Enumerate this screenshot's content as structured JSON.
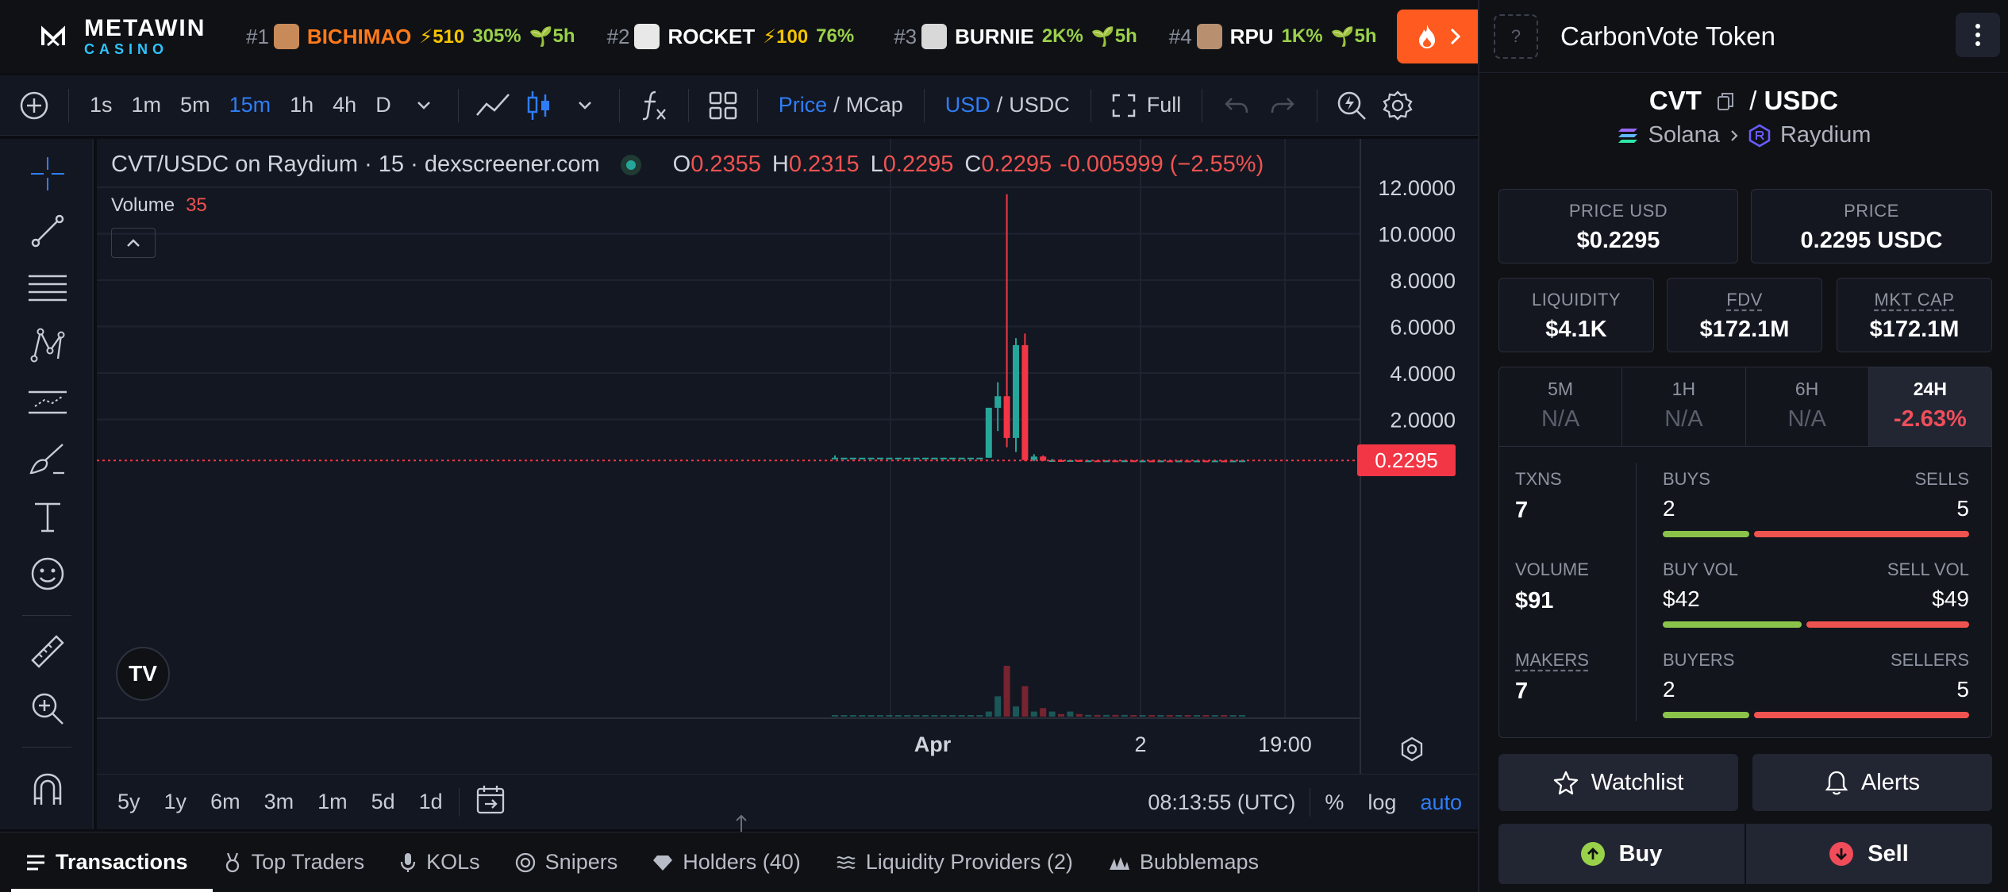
{
  "ticker": {
    "logo": {
      "line1": "METAWIN",
      "line2": "CASINO"
    },
    "items": [
      {
        "rank": "#1",
        "symbol": "BICHIMAO",
        "boost": "⚡510",
        "change": "305%",
        "age": "5h",
        "symbol_color": "#ff7a1a",
        "avatar_color": "#c98a5a"
      },
      {
        "rank": "#2",
        "symbol": "ROCKET",
        "boost": "⚡100",
        "change": "76%",
        "age": "",
        "symbol_color": "#ffffff",
        "avatar_color": "#e8e8e8"
      },
      {
        "rank": "#3",
        "symbol": "BURNIE",
        "boost": "",
        "change": "2K%",
        "age": "5h",
        "symbol_color": "#ffffff",
        "avatar_color": "#d8d8d8"
      },
      {
        "rank": "#4",
        "symbol": "RPU",
        "boost": "",
        "change": "1K%",
        "age": "5h",
        "symbol_color": "#ffffff",
        "avatar_color": "#b89070"
      }
    ]
  },
  "toolbar": {
    "intervals": [
      "1s",
      "1m",
      "5m",
      "15m",
      "1h",
      "4h",
      "D"
    ],
    "active_interval": "15m",
    "price_label": "Price",
    "mcap_label": "MCap",
    "usd_label": "USD",
    "usdc_label": "USDC",
    "full_label": "Full"
  },
  "chart": {
    "legend_title": "CVT/USDC on Raydium · 15 · dexscreener.com",
    "ohlc": {
      "o": "0.2355",
      "h": "0.2315",
      "l": "0.2295",
      "c": "0.2295",
      "change": "-0.005999 (−2.55%)"
    },
    "volume_label": "Volume",
    "volume_value": "35",
    "y_ticks": [
      "12.0000",
      "10.0000",
      "8.0000",
      "6.0000",
      "4.0000",
      "2.0000"
    ],
    "x_ticks": [
      "Apr",
      "2",
      "19:00"
    ],
    "price_tag": "0.2295",
    "range_buttons": [
      "5y",
      "1y",
      "6m",
      "3m",
      "1m",
      "5d",
      "1d"
    ],
    "clock": "08:13:55 (UTC)",
    "pct_label": "%",
    "log_label": "log",
    "auto_label": "auto",
    "logo_text": "TV"
  },
  "chart_data": {
    "type": "candlestick",
    "title": "CVT/USDC on Raydium · 15 · dexscreener.com",
    "ylim": [
      0,
      13
    ],
    "candles": [
      {
        "o": 0.35,
        "h": 0.45,
        "l": 0.3,
        "c": 0.35
      },
      {
        "o": 0.35,
        "h": 0.35,
        "l": 0.35,
        "c": 0.35
      },
      {
        "o": 0.35,
        "h": 0.35,
        "l": 0.35,
        "c": 0.35
      },
      {
        "o": 0.35,
        "h": 0.35,
        "l": 0.35,
        "c": 0.35
      },
      {
        "o": 0.35,
        "h": 0.35,
        "l": 0.35,
        "c": 0.35
      },
      {
        "o": 0.35,
        "h": 0.35,
        "l": 0.35,
        "c": 0.35
      },
      {
        "o": 0.35,
        "h": 0.35,
        "l": 0.35,
        "c": 0.35
      },
      {
        "o": 0.35,
        "h": 0.35,
        "l": 0.35,
        "c": 0.35
      },
      {
        "o": 0.35,
        "h": 0.35,
        "l": 0.35,
        "c": 0.35
      },
      {
        "o": 0.35,
        "h": 0.35,
        "l": 0.35,
        "c": 0.35
      },
      {
        "o": 0.35,
        "h": 0.35,
        "l": 0.35,
        "c": 0.35
      },
      {
        "o": 0.35,
        "h": 0.35,
        "l": 0.35,
        "c": 0.35
      },
      {
        "o": 0.35,
        "h": 0.35,
        "l": 0.35,
        "c": 0.35
      },
      {
        "o": 0.35,
        "h": 0.35,
        "l": 0.35,
        "c": 0.35
      },
      {
        "o": 0.35,
        "h": 0.35,
        "l": 0.35,
        "c": 0.35
      },
      {
        "o": 0.35,
        "h": 0.35,
        "l": 0.35,
        "c": 0.35
      },
      {
        "o": 0.35,
        "h": 0.35,
        "l": 0.35,
        "c": 0.35
      },
      {
        "o": 0.35,
        "h": 2.5,
        "l": 0.35,
        "c": 2.5
      },
      {
        "o": 2.5,
        "h": 3.6,
        "l": 1.5,
        "c": 3.0
      },
      {
        "o": 3.0,
        "h": 11.7,
        "l": 0.8,
        "c": 1.2
      },
      {
        "o": 1.2,
        "h": 5.5,
        "l": 0.6,
        "c": 5.2
      },
      {
        "o": 5.2,
        "h": 5.7,
        "l": 0.2,
        "c": 0.25
      },
      {
        "o": 0.25,
        "h": 0.5,
        "l": 0.2,
        "c": 0.4
      },
      {
        "o": 0.4,
        "h": 0.45,
        "l": 0.2,
        "c": 0.22
      },
      {
        "o": 0.22,
        "h": 0.3,
        "l": 0.2,
        "c": 0.24
      },
      {
        "o": 0.24,
        "h": 0.28,
        "l": 0.2,
        "c": 0.22
      },
      {
        "o": 0.22,
        "h": 0.26,
        "l": 0.2,
        "c": 0.24
      },
      {
        "o": 0.24,
        "h": 0.26,
        "l": 0.2,
        "c": 0.22
      },
      {
        "o": 0.22,
        "h": 0.24,
        "l": 0.2,
        "c": 0.23
      },
      {
        "o": 0.23,
        "h": 0.24,
        "l": 0.21,
        "c": 0.22
      },
      {
        "o": 0.22,
        "h": 0.24,
        "l": 0.21,
        "c": 0.23
      },
      {
        "o": 0.23,
        "h": 0.24,
        "l": 0.21,
        "c": 0.22
      },
      {
        "o": 0.22,
        "h": 0.24,
        "l": 0.21,
        "c": 0.23
      },
      {
        "o": 0.23,
        "h": 0.24,
        "l": 0.21,
        "c": 0.22
      },
      {
        "o": 0.22,
        "h": 0.23,
        "l": 0.21,
        "c": 0.225
      },
      {
        "o": 0.225,
        "h": 0.23,
        "l": 0.21,
        "c": 0.22
      },
      {
        "o": 0.22,
        "h": 0.23,
        "l": 0.21,
        "c": 0.225
      },
      {
        "o": 0.225,
        "h": 0.23,
        "l": 0.21,
        "c": 0.22
      },
      {
        "o": 0.22,
        "h": 0.23,
        "l": 0.21,
        "c": 0.225
      },
      {
        "o": 0.225,
        "h": 0.23,
        "l": 0.21,
        "c": 0.22
      },
      {
        "o": 0.22,
        "h": 0.23,
        "l": 0.21,
        "c": 0.225
      },
      {
        "o": 0.225,
        "h": 0.23,
        "l": 0.21,
        "c": 0.22
      },
      {
        "o": 0.22,
        "h": 0.23,
        "l": 0.21,
        "c": 0.225
      },
      {
        "o": 0.225,
        "h": 0.23,
        "l": 0.21,
        "c": 0.22
      },
      {
        "o": 0.22,
        "h": 0.23,
        "l": 0.21,
        "c": 0.225
      },
      {
        "o": 0.225,
        "h": 0.23,
        "l": 0.22,
        "c": 0.2295
      }
    ],
    "volume": [
      0.5,
      0.3,
      0.3,
      0.3,
      0.3,
      0.3,
      0.3,
      0.3,
      0.3,
      0.3,
      0.3,
      0.3,
      0.3,
      0.3,
      0.3,
      0.3,
      0.3,
      3,
      12,
      30,
      6,
      18,
      3,
      5,
      3,
      1.5,
      3,
      1.5,
      1,
      1,
      1,
      1,
      1,
      0.8,
      0.8,
      0.8,
      0.8,
      0.6,
      0.6,
      0.6,
      0.6,
      0.5,
      0.5,
      0.5,
      0.5,
      0.5
    ],
    "last_price": 0.2295
  },
  "panel": {
    "token_name": "CarbonVote Token",
    "avatar_placeholder": "?",
    "base": "CVT",
    "quote": "USDC",
    "chain": "Solana",
    "dex": "Raydium",
    "price_usd_label": "PRICE USD",
    "price_usd": "$0.2295",
    "price_label": "PRICE",
    "price": "0.2295 USDC",
    "liquidity_label": "LIQUIDITY",
    "liquidity": "$4.1K",
    "fdv_label": "FDV",
    "fdv": "$172.1M",
    "mcap_label": "MKT CAP",
    "mcap": "$172.1M",
    "periods": [
      {
        "label": "5M",
        "value": "N/A"
      },
      {
        "label": "1H",
        "value": "N/A"
      },
      {
        "label": "6H",
        "value": "N/A"
      },
      {
        "label": "24H",
        "value": "-2.63%"
      }
    ],
    "txns_label": "TXNS",
    "txns": "7",
    "volume_label": "VOLUME",
    "volume": "$91",
    "makers_label": "MAKERS",
    "makers": "7",
    "buys_label": "BUYS",
    "buys": "2",
    "sells_label": "SELLS",
    "sells": "5",
    "buys_share": 0.286,
    "buy_vol_label": "BUY VOL",
    "buy_vol": "$42",
    "sell_vol_label": "SELL VOL",
    "sell_vol": "$49",
    "buy_vol_share": 0.46,
    "buyers_label": "BUYERS",
    "buyers": "2",
    "sellers_label": "SELLERS",
    "sellers": "5",
    "buyers_share": 0.286,
    "watchlist_label": "Watchlist",
    "alerts_label": "Alerts",
    "buy_label": "Buy",
    "sell_label": "Sell"
  },
  "tabs": {
    "items": [
      {
        "label": "Transactions",
        "icon": "list-icon"
      },
      {
        "label": "Top Traders",
        "icon": "medal-icon"
      },
      {
        "label": "KOLs",
        "icon": "microphone-icon"
      },
      {
        "label": "Snipers",
        "icon": "target-icon"
      },
      {
        "label": "Holders (40)",
        "icon": "diamond-icon"
      },
      {
        "label": "Liquidity Providers (2)",
        "icon": "waves-icon"
      },
      {
        "label": "Bubblemaps",
        "icon": "bubbles-icon"
      }
    ]
  },
  "colors": {
    "up": "#26a69a",
    "down": "#f23645",
    "accent": "#2f7df6",
    "buy": "#8bc34a",
    "sell": "#ef5350"
  }
}
